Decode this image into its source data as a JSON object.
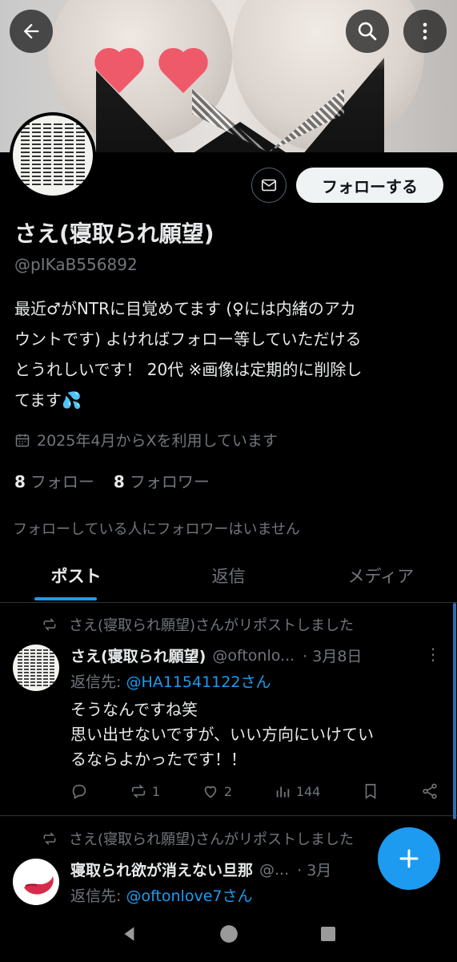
{
  "header": {
    "back_icon": "arrow-left-icon",
    "search_icon": "search-icon",
    "more_icon": "more-vertical-icon"
  },
  "profile": {
    "name": "さえ(寝取られ願望)",
    "handle": "@pIKaB556892",
    "follow_label": "フォローする",
    "bio_lines": [
      "最近♂がNTRに目覚めてます (♀には内緒のアカ",
      "ウントです) よければフォロー等していただける",
      "とうれしいです！ 20代 ※画像は定期的に削除し",
      "てます💦"
    ],
    "joined": "2025年4月からXを利用しています",
    "following_count": "8",
    "following_label": "フォロー",
    "followers_count": "8",
    "followers_label": "フォロワー",
    "no_mutual_followers": "フォローしている人にフォロワーはいません"
  },
  "tabs": [
    {
      "label": "ポスト",
      "active": true
    },
    {
      "label": "返信",
      "active": false
    },
    {
      "label": "メディア",
      "active": false
    }
  ],
  "posts": [
    {
      "repost_note": "さえ(寝取られ願望)さんがリポストしました",
      "author": "さえ(寝取られ願望)",
      "handle": "@oftonlo...",
      "date": "· 3月8日",
      "reply_prefix": "返信先: ",
      "reply_to": "@HA11541122さん",
      "text": "そうなんですね笑\n思い出せないですが、いい方向にいけてい\nるならよかったです！！",
      "replies": "",
      "reposts": "1",
      "likes": "2",
      "views": "144"
    },
    {
      "repost_note": "さえ(寝取られ願望)さんがリポストしました",
      "author": "寝取られ欲が消えない旦那",
      "handle": "@...",
      "date": "· 3月",
      "reply_prefix": "返信先: ",
      "reply_to": "@oftonlove7さん"
    }
  ],
  "colors": {
    "background": "#000000",
    "accent": "#1d9bf0",
    "muted": "#71767b",
    "heart": "#ef5a6b"
  }
}
